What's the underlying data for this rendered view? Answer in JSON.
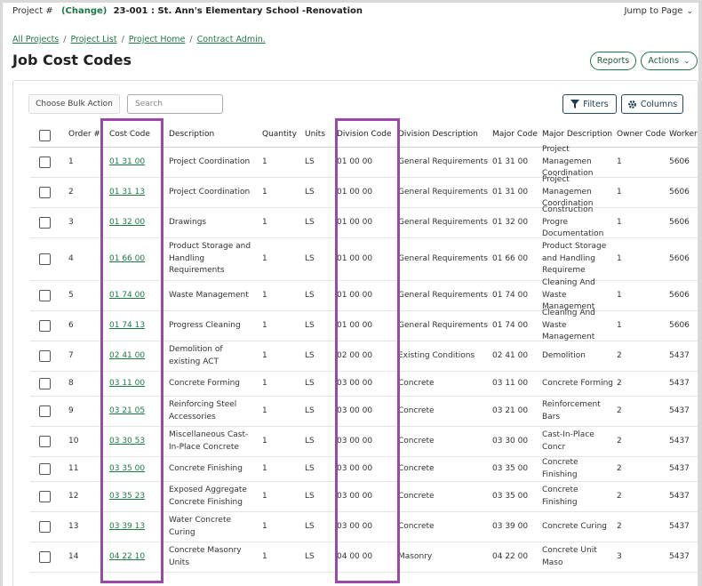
{
  "topbar": {
    "project_label": "Project #",
    "change_label": "(Change)",
    "project_name": "23-001 : St. Ann's Elementary School -Renovation",
    "jump_label": "Jump to Page"
  },
  "breadcrumb": [
    "All Projects",
    "Project List",
    "Project Home",
    "Contract Admin."
  ],
  "page_title": "Job Cost Codes",
  "header_buttons": {
    "reports": "Reports",
    "actions": "Actions"
  },
  "toolbar": {
    "bulk_action": "Choose Bulk Action",
    "search_placeholder": "Search",
    "filters": "Filters",
    "columns": "Columns"
  },
  "columns": [
    "Order #",
    "Cost Code",
    "Description",
    "Quantity",
    "Units",
    "Division Code",
    "Division Description",
    "Major Code",
    "Major Description",
    "Owner Code",
    "Workers"
  ],
  "rows": [
    {
      "order": "1",
      "cost": "01 31 00",
      "desc": "Project Coordination",
      "qty": "1",
      "units": "LS",
      "div": "01 00 00",
      "divdesc": "General Requirements",
      "major": "01 31 00",
      "majdesc": "Project Managemen Coordination",
      "owner": "1",
      "work": "5606"
    },
    {
      "order": "2",
      "cost": "01 31 13",
      "desc": "Project Coordination",
      "qty": "1",
      "units": "LS",
      "div": "01 00 00",
      "divdesc": "General Requirements",
      "major": "01 31 00",
      "majdesc": "Project Managemen Coordination",
      "owner": "1",
      "work": "5606"
    },
    {
      "order": "3",
      "cost": "01 32 00",
      "desc": "Drawings",
      "qty": "1",
      "units": "LS",
      "div": "01 00 00",
      "divdesc": "General Requirements",
      "major": "01 32 00",
      "majdesc": "Construction Progre Documentation",
      "owner": "1",
      "work": "5606"
    },
    {
      "order": "4",
      "cost": "01 66 00",
      "desc": "Product Storage and Handling Requirements",
      "qty": "1",
      "units": "LS",
      "div": "01 00 00",
      "divdesc": "General Requirements",
      "major": "01 66 00",
      "majdesc": "Product Storage and Handling Requireme",
      "owner": "1",
      "work": "5606"
    },
    {
      "order": "5",
      "cost": "01 74 00",
      "desc": "Waste Management",
      "qty": "1",
      "units": "LS",
      "div": "01 00 00",
      "divdesc": "General Requirements",
      "major": "01 74 00",
      "majdesc": "Cleaning And Waste Management",
      "owner": "1",
      "work": "5606"
    },
    {
      "order": "6",
      "cost": "01 74 13",
      "desc": "Progress Cleaning",
      "qty": "1",
      "units": "LS",
      "div": "01 00 00",
      "divdesc": "General Requirements",
      "major": "01 74 00",
      "majdesc": "Cleaning And Waste Management",
      "owner": "1",
      "work": "5606"
    },
    {
      "order": "7",
      "cost": "02 41 00",
      "desc": "Demolition of existing ACT",
      "qty": "1",
      "units": "LS",
      "div": "02 00 00",
      "divdesc": "Existing Conditions",
      "major": "02 41 00",
      "majdesc": "Demolition",
      "owner": "2",
      "work": "5437"
    },
    {
      "order": "8",
      "cost": "03 11 00",
      "desc": "Concrete Forming",
      "qty": "1",
      "units": "LS",
      "div": "03 00 00",
      "divdesc": "Concrete",
      "major": "03 11 00",
      "majdesc": "Concrete Forming",
      "owner": "2",
      "work": "5437"
    },
    {
      "order": "9",
      "cost": "03 21 05",
      "desc": "Reinforcing Steel Accessories",
      "qty": "1",
      "units": "LS",
      "div": "03 00 00",
      "divdesc": "Concrete",
      "major": "03 21 00",
      "majdesc": "Reinforcement Bars",
      "owner": "2",
      "work": "5437"
    },
    {
      "order": "10",
      "cost": "03 30 53",
      "desc": "Miscellaneous Cast-In-Place Concrete",
      "qty": "1",
      "units": "LS",
      "div": "03 00 00",
      "divdesc": "Concrete",
      "major": "03 30 00",
      "majdesc": "Cast-In-Place Concr",
      "owner": "2",
      "work": "5437"
    },
    {
      "order": "11",
      "cost": "03 35 00",
      "desc": "Concrete Finishing",
      "qty": "1",
      "units": "LS",
      "div": "03 00 00",
      "divdesc": "Concrete",
      "major": "03 35 00",
      "majdesc": "Concrete Finishing",
      "owner": "2",
      "work": "5437"
    },
    {
      "order": "12",
      "cost": "03 35 23",
      "desc": "Exposed Aggregate Concrete Finishing",
      "qty": "1",
      "units": "LS",
      "div": "03 00 00",
      "divdesc": "Concrete",
      "major": "03 35 00",
      "majdesc": "Concrete Finishing",
      "owner": "2",
      "work": "5437"
    },
    {
      "order": "13",
      "cost": "03 39 13",
      "desc": "Water Concrete Curing",
      "qty": "1",
      "units": "LS",
      "div": "03 00 00",
      "divdesc": "Concrete",
      "major": "03 39 00",
      "majdesc": "Concrete Curing",
      "owner": "2",
      "work": "5437"
    },
    {
      "order": "14",
      "cost": "04 22 10",
      "desc": "Concrete Masonry Units",
      "qty": "1",
      "units": "LS",
      "div": "04 00 00",
      "divdesc": "Masonry",
      "major": "04 22 00",
      "majdesc": "Concrete Unit Maso",
      "owner": "3",
      "work": "5437"
    }
  ],
  "colors": {
    "accent": "#1e7a45",
    "highlight": "#9b49a6"
  }
}
